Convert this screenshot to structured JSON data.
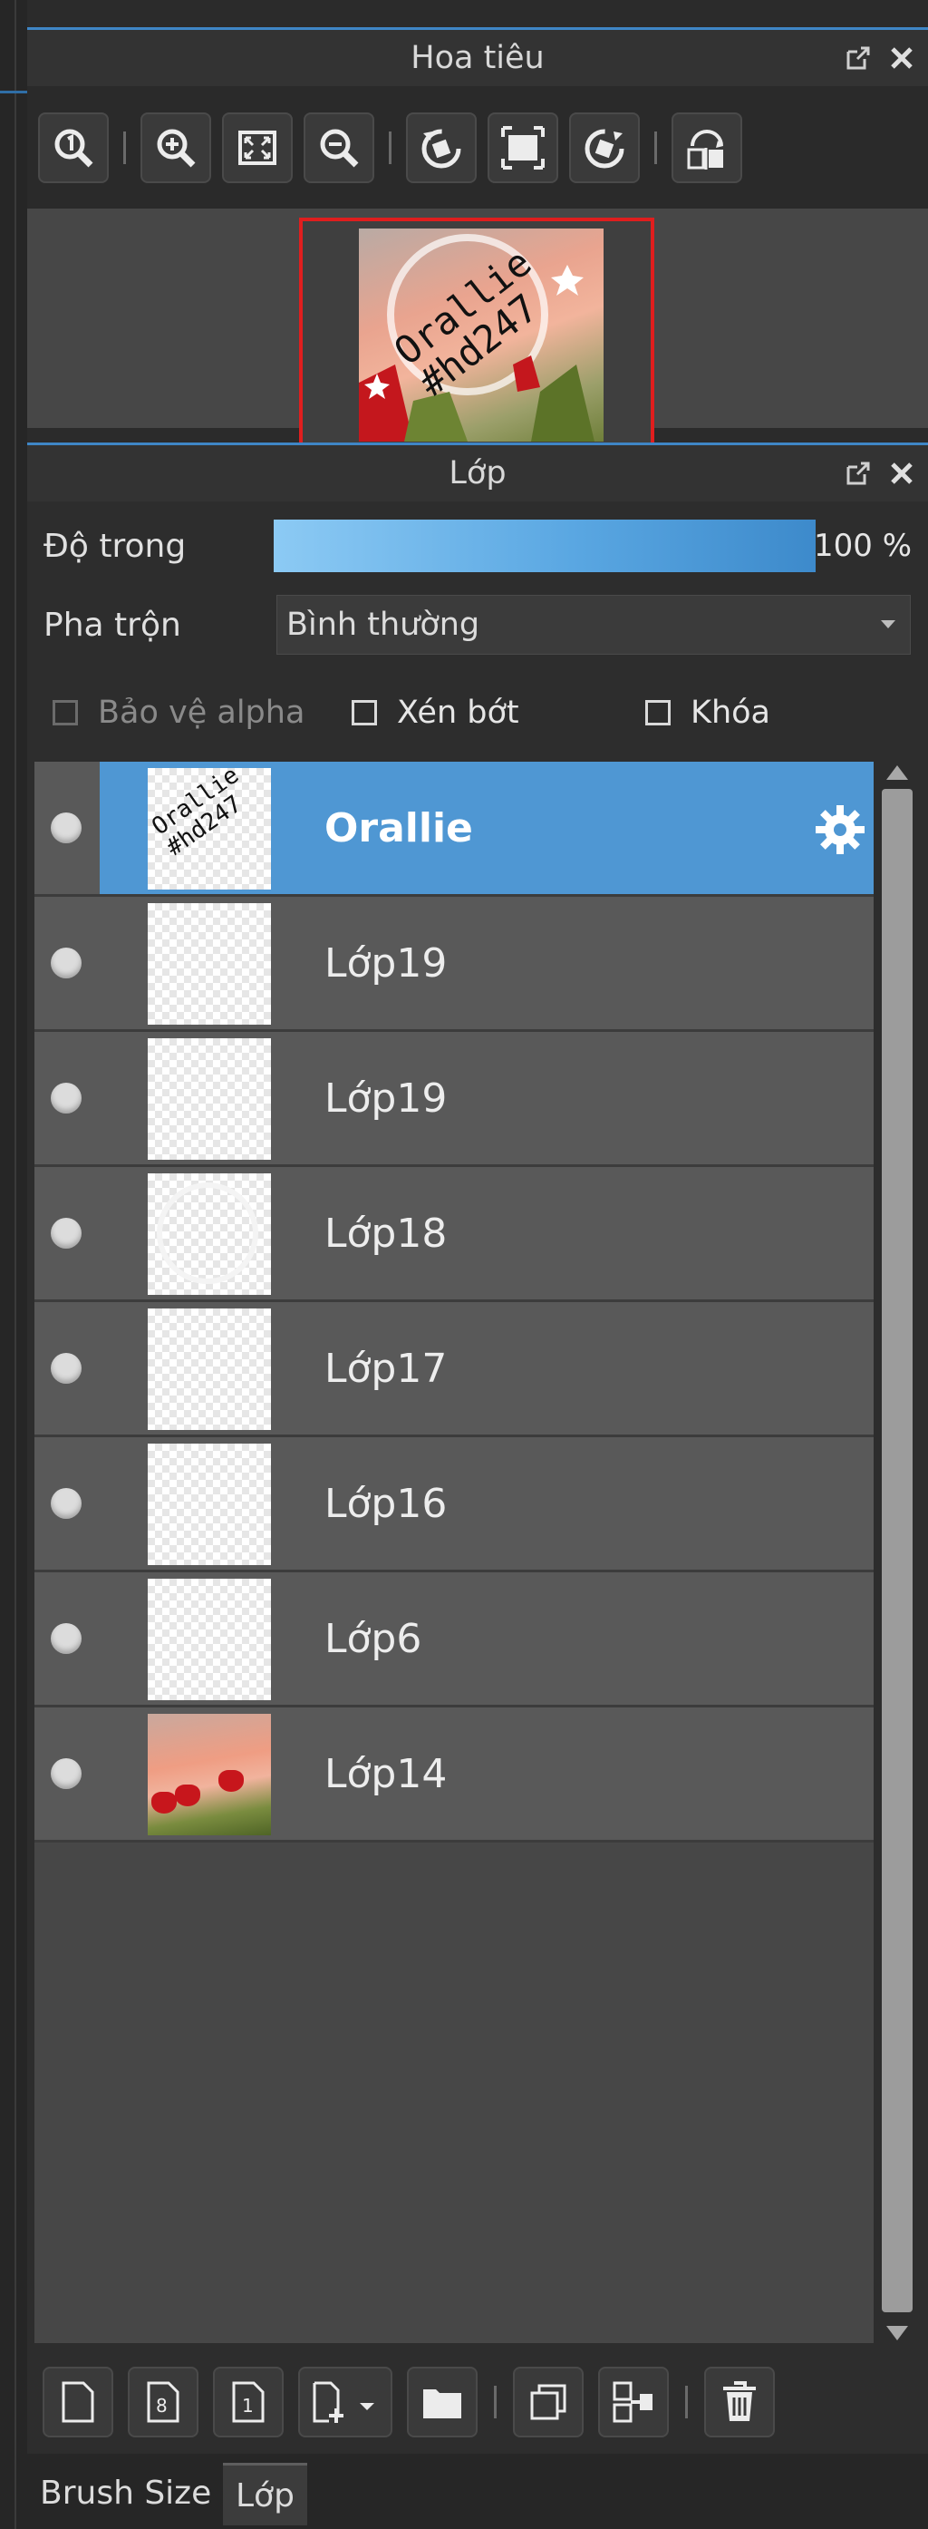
{
  "navigator": {
    "title": "Hoa tiêu",
    "toolbar": [
      "zoom-actual-icon",
      "zoom-in-icon",
      "fit-screen-icon",
      "zoom-out-icon",
      "rotate-left-icon",
      "fit-window-icon",
      "rotate-right-icon",
      "flip-horizontal-icon"
    ],
    "preview_text": "Orallie\n#hd247"
  },
  "layers": {
    "title": "Lớp",
    "opacity_label": "Độ trong",
    "opacity_value": "100 %",
    "opacity_fraction": 1.0,
    "blend_label": "Pha trộn",
    "blend_value": "Bình thường",
    "alpha_protect": "Bảo vệ alpha",
    "clipping": "Xén bớt",
    "lock": "Khóa",
    "items": [
      {
        "name": "Orallie",
        "selected": true,
        "thumb": "text",
        "thumb_text": "Orallie\n#hd247"
      },
      {
        "name": "Lớp19",
        "selected": false,
        "thumb": "empty"
      },
      {
        "name": "Lớp19",
        "selected": false,
        "thumb": "empty"
      },
      {
        "name": "Lớp18",
        "selected": false,
        "thumb": "ring"
      },
      {
        "name": "Lớp17",
        "selected": false,
        "thumb": "empty"
      },
      {
        "name": "Lớp16",
        "selected": false,
        "thumb": "empty"
      },
      {
        "name": "Lớp6",
        "selected": false,
        "thumb": "empty"
      },
      {
        "name": "Lớp14",
        "selected": false,
        "thumb": "photo"
      }
    ]
  },
  "tabs": [
    "Brush Size",
    "Lớp"
  ],
  "colors": {
    "accent": "#4f97d3",
    "preview_border": "#e01e1e",
    "opacity_bar": "#5aa7e2"
  }
}
